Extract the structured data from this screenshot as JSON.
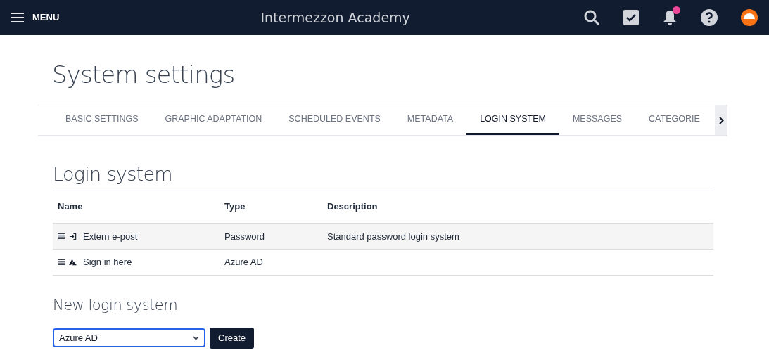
{
  "header": {
    "menu_label": "MENU",
    "title": "Intermezzon Academy",
    "notification_badge": true
  },
  "page_title": "System settings",
  "tabs": [
    {
      "label": "BASIC SETTINGS",
      "selected": false
    },
    {
      "label": "GRAPHIC ADAPTATION",
      "selected": false
    },
    {
      "label": "SCHEDULED EVENTS",
      "selected": false
    },
    {
      "label": "METADATA",
      "selected": false
    },
    {
      "label": "LOGIN SYSTEM",
      "selected": true
    },
    {
      "label": "MESSAGES",
      "selected": false
    },
    {
      "label": "CATEGORIE",
      "selected": false
    }
  ],
  "section_title": "Login system",
  "table": {
    "columns": [
      "Name",
      "Type",
      "Description"
    ],
    "rows": [
      {
        "kind": "password",
        "name": "Extern e-post",
        "type": "Password",
        "description": "Standard password login system"
      },
      {
        "kind": "azure",
        "name": "Sign in here",
        "type": "Azure AD"
      }
    ]
  },
  "new_section": {
    "title": "New login system",
    "select_value": "Azure AD",
    "button": "Create"
  }
}
